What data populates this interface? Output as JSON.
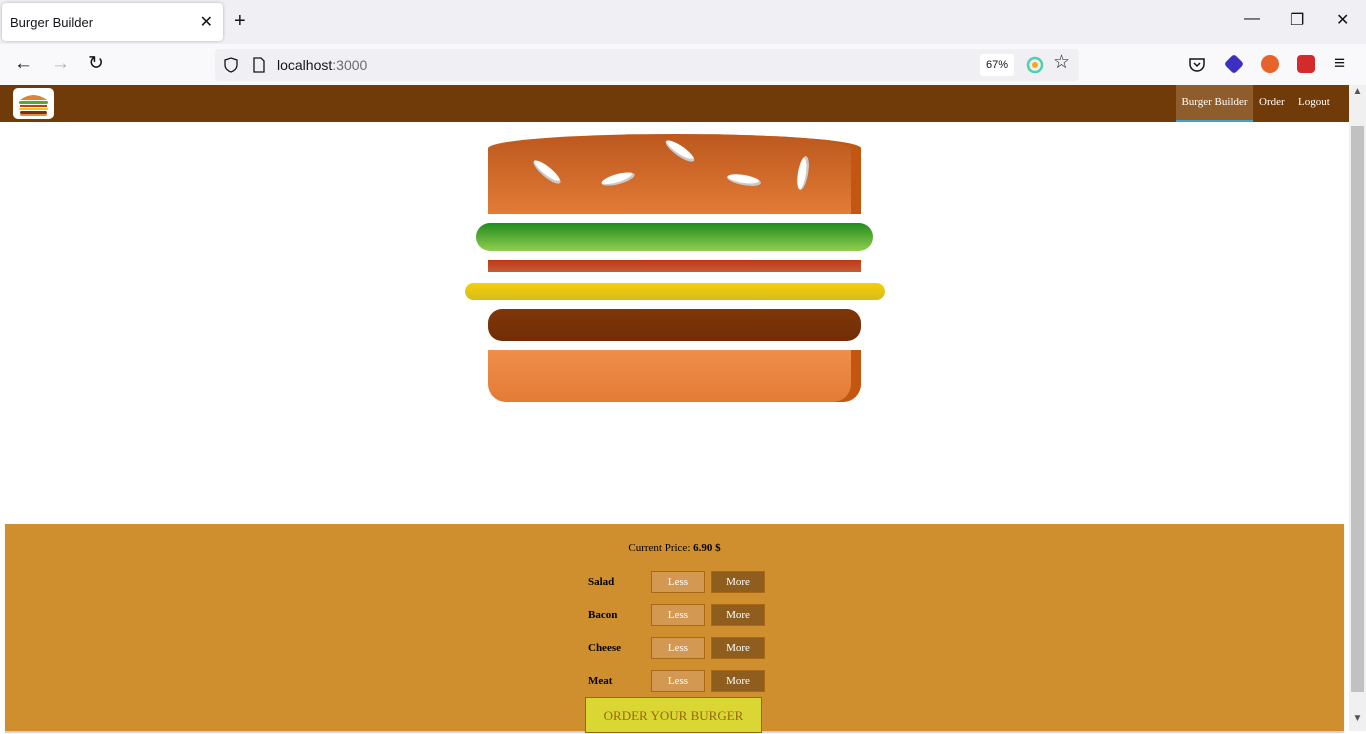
{
  "browser": {
    "tab_title": "Burger Builder",
    "tab_close": "✕",
    "new_tab": "+",
    "url_host": "localhost",
    "url_port": ":3000",
    "zoom": "67%",
    "window_controls": {
      "minimize": "—",
      "restore": "❐",
      "close": "✕"
    },
    "nav_icons": {
      "back": "←",
      "forward": "→",
      "reload": "↻",
      "menu": "≡",
      "star": "☆"
    }
  },
  "toolbar": {
    "nav_items": [
      {
        "label": "Burger Builder",
        "active": true
      },
      {
        "label": "Order",
        "active": false
      },
      {
        "label": "Logout",
        "active": false
      }
    ]
  },
  "build_controls": {
    "price_label": "Current Price: ",
    "price_value": "6.90 $",
    "ingredients": [
      {
        "label": "Salad",
        "less": "Less",
        "more": "More"
      },
      {
        "label": "Bacon",
        "less": "Less",
        "more": "More"
      },
      {
        "label": "Cheese",
        "less": "Less",
        "more": "More"
      },
      {
        "label": "Meat",
        "less": "Less",
        "more": "More"
      }
    ],
    "order_button": "ORDER YOUR BURGER"
  },
  "colors": {
    "toolbar": "#703b09",
    "controls_bg": "#cf8f2e",
    "order_button_bg": "#dad735"
  }
}
